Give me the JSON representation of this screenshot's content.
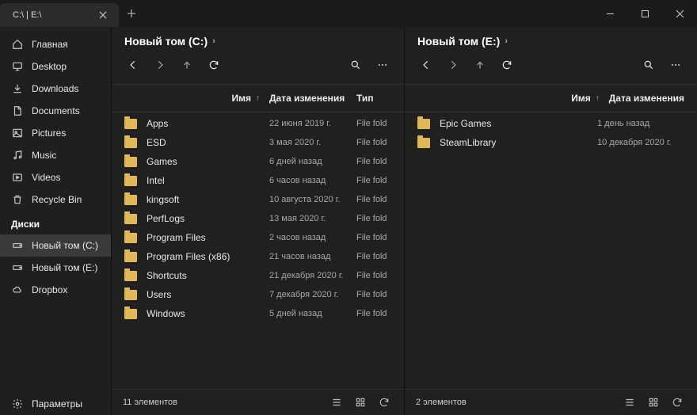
{
  "titlebar": {
    "tab_title": "C:\\ | E:\\"
  },
  "sidebar": {
    "items": [
      {
        "icon": "home",
        "label": "Главная"
      },
      {
        "icon": "desktop",
        "label": "Desktop"
      },
      {
        "icon": "download",
        "label": "Downloads"
      },
      {
        "icon": "document",
        "label": "Documents"
      },
      {
        "icon": "picture",
        "label": "Pictures"
      },
      {
        "icon": "music",
        "label": "Music"
      },
      {
        "icon": "video",
        "label": "Videos"
      },
      {
        "icon": "trash",
        "label": "Recycle Bin"
      }
    ],
    "drives_header": "Диски",
    "drives": [
      {
        "icon": "drive",
        "label": "Новый том (C:)",
        "active": true
      },
      {
        "icon": "drive",
        "label": "Новый том (E:)"
      },
      {
        "icon": "cloud",
        "label": "Dropbox"
      }
    ],
    "settings_label": "Параметры"
  },
  "panes": [
    {
      "title": "Новый том (C:)",
      "columns": {
        "name": "Имя",
        "date": "Дата изменения",
        "type": "Тип"
      },
      "files": [
        {
          "name": "Apps",
          "date": "22 июня 2019 г.",
          "type": "File folder"
        },
        {
          "name": "ESD",
          "date": "3 мая 2020 г.",
          "type": "File folder"
        },
        {
          "name": "Games",
          "date": "6 дней назад",
          "type": "File folder"
        },
        {
          "name": "Intel",
          "date": "6 часов назад",
          "type": "File folder"
        },
        {
          "name": "kingsoft",
          "date": "10 августа 2020 г.",
          "type": "File folder"
        },
        {
          "name": "PerfLogs",
          "date": "13 мая 2020 г.",
          "type": "File folder"
        },
        {
          "name": "Program Files",
          "date": "2 часов назад",
          "type": "File folder"
        },
        {
          "name": "Program Files (x86)",
          "date": "21 часов назад",
          "type": "File folder"
        },
        {
          "name": "Shortcuts",
          "date": "21 декабря 2020 г.",
          "type": "File folder"
        },
        {
          "name": "Users",
          "date": "7 декабря 2020 г.",
          "type": "File folder"
        },
        {
          "name": "Windows",
          "date": "5 дней назад",
          "type": "File folder"
        }
      ],
      "status": "11 элементов"
    },
    {
      "title": "Новый том (E:)",
      "columns": {
        "name": "Имя",
        "date": "Дата изменения"
      },
      "files": [
        {
          "name": "Epic Games",
          "date": "1 день назад"
        },
        {
          "name": "SteamLibrary",
          "date": "10 декабря 2020 г."
        }
      ],
      "status": "2 элементов"
    }
  ]
}
